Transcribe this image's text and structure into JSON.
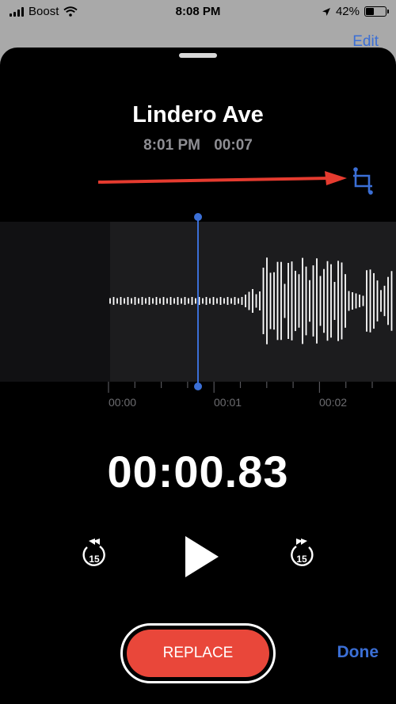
{
  "status_bar": {
    "carrier": "Boost",
    "time": "8:08 PM",
    "battery": "42%",
    "battery_level": 0.42
  },
  "background": {
    "edit_label": "Edit"
  },
  "recording": {
    "title": "Lindero Ave",
    "time": "8:01 PM",
    "duration": "00:07"
  },
  "timeline": {
    "ticks": [
      "00:00",
      "00:01",
      "00:02"
    ]
  },
  "playback": {
    "elapsed": "00:00.83",
    "skip_back": "15",
    "skip_forward": "15"
  },
  "actions": {
    "replace_label": "REPLACE",
    "done_label": "Done"
  },
  "colors": {
    "accent": "#3b6fd6",
    "record_red": "#e9473a",
    "annotation_arrow": "#e53b2f"
  },
  "icons": [
    "wifi-icon",
    "location-icon",
    "battery-icon",
    "trim-icon",
    "skip-back-15-icon",
    "play-icon",
    "skip-forward-15-icon"
  ]
}
